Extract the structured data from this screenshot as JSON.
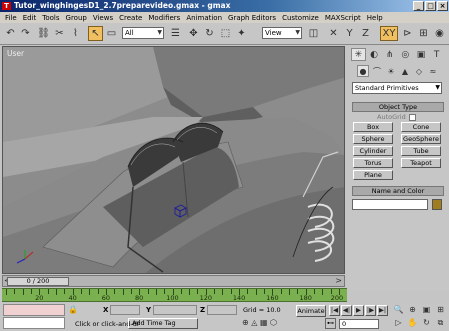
{
  "window": {
    "title": "Tutor_winghingesD1_2.7preparevideo.gmax - gmax",
    "app_icon_letter": "T",
    "minimize": "_",
    "maximize": "□",
    "close": "×"
  },
  "menu": [
    "File",
    "Edit",
    "Tools",
    "Group",
    "Views",
    "Create",
    "Modifiers",
    "Animation",
    "Graph Editors",
    "Customize",
    "MAXScript",
    "Help"
  ],
  "toolbar": {
    "selection_filter": "All",
    "reference_coord": "View"
  },
  "viewport": {
    "label": "User"
  },
  "command_panel": {
    "category_dropdown": "Standard Primitives",
    "object_type_header": "Object Type",
    "autogrid_label": "AutoGrid",
    "buttons": [
      "Box",
      "Cone",
      "Sphere",
      "GeoSphere",
      "Cylinder",
      "Tube",
      "Torus",
      "Teapot",
      "Plane"
    ],
    "name_color_header": "Name and Color",
    "object_color": "#a07e20"
  },
  "timeslider": {
    "position_text": "0 / 200",
    "prev_arrow": "<",
    "next_arrow": ">"
  },
  "trackbar": {
    "tick_labels": [
      "20",
      "40",
      "60",
      "80",
      "100",
      "120",
      "140",
      "160",
      "180",
      "200"
    ],
    "color": "#7ab050"
  },
  "status": {
    "prompt": "Click or click-and-dr",
    "add_time_tag": "Add Time Tag",
    "x_label": "X",
    "y_label": "Y",
    "z_label": "Z",
    "grid_text": "Grid = 10.0",
    "animate_label": "Animate",
    "frame_value": "0"
  }
}
